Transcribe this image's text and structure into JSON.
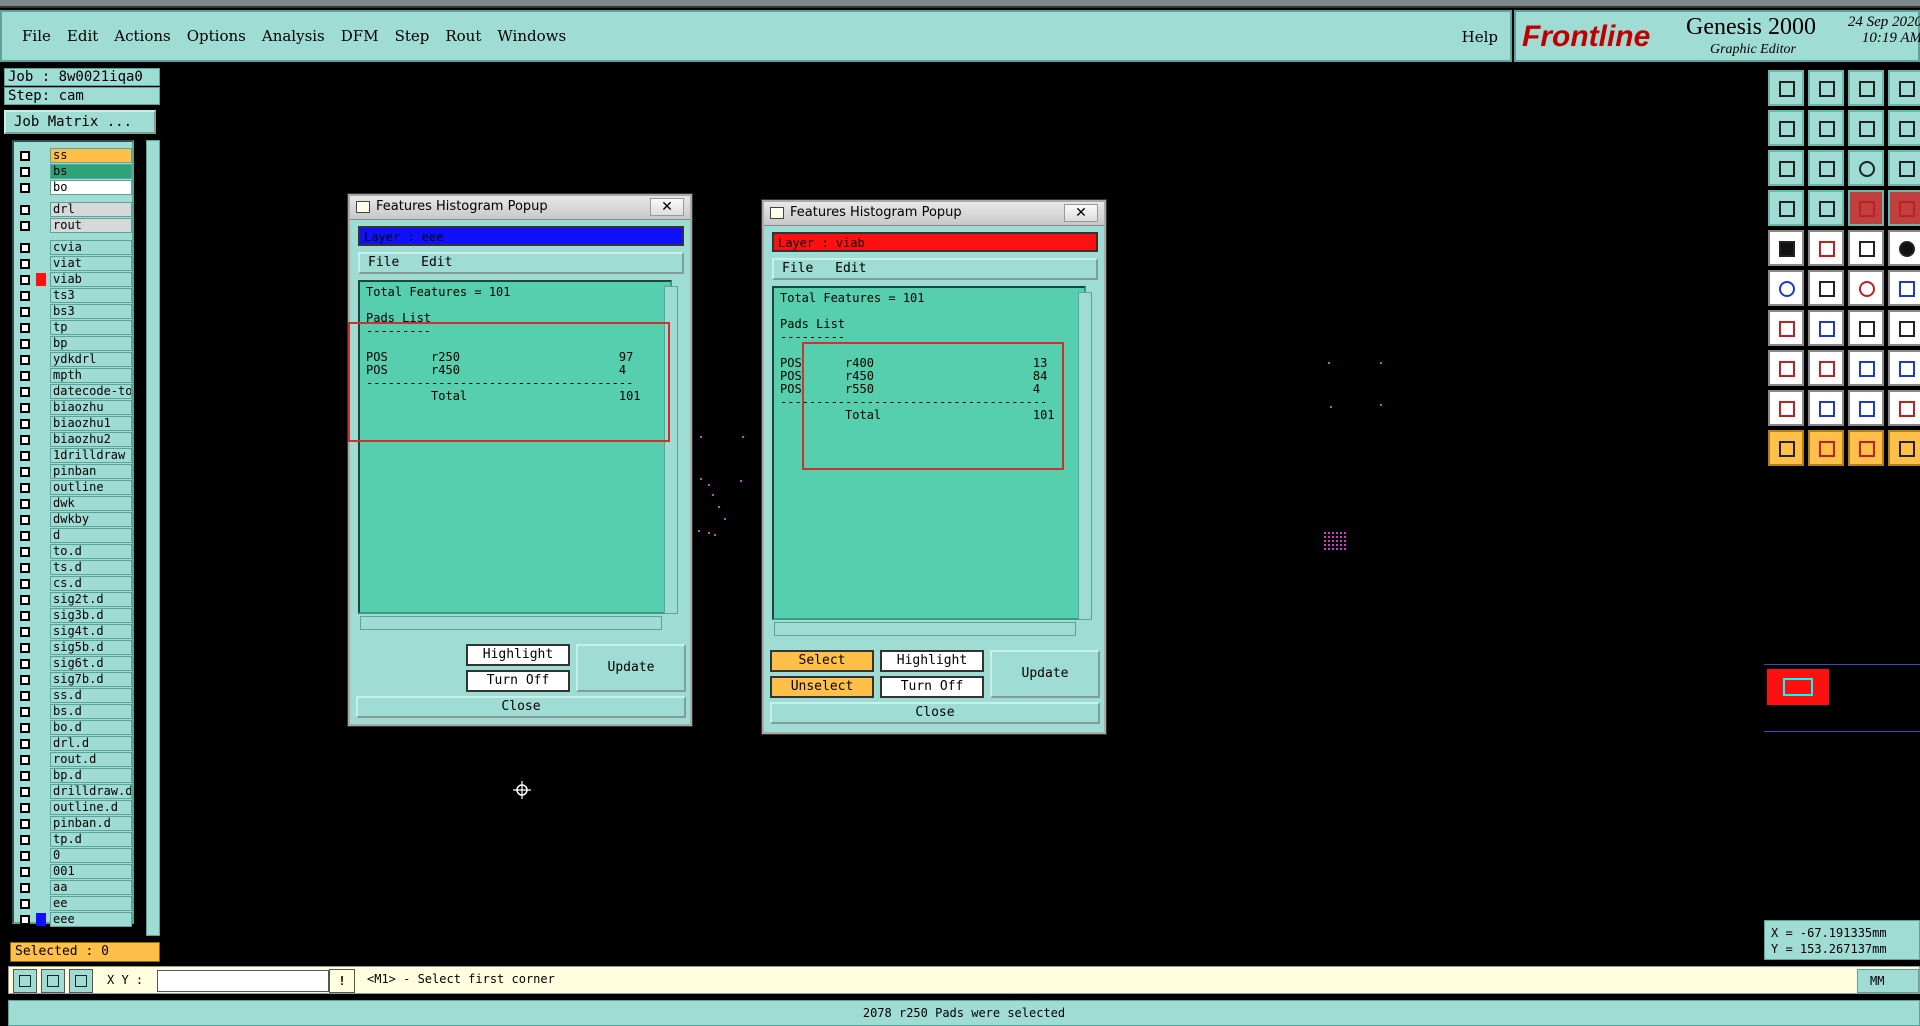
{
  "menubar": {
    "items": [
      "File",
      "Edit",
      "Actions",
      "Options",
      "Analysis",
      "DFM",
      "Step",
      "Rout",
      "Windows"
    ],
    "help": "Help"
  },
  "brand": {
    "logo_text": "Frontline",
    "product": "Genesis 2000",
    "subtitle": "Graphic Editor",
    "date": "24 Sep 2020",
    "time": "10:19 AM"
  },
  "job": {
    "job_label": "Job : 8w0021iqa0",
    "step_label": "Step: cam",
    "matrix_button": "Job Matrix ..."
  },
  "layers": [
    {
      "name": "ss",
      "color": "#ffc04a"
    },
    {
      "name": "bs",
      "color": "#2ea37a"
    },
    {
      "name": "bo",
      "color": "#ffffff"
    },
    {
      "name": "drl",
      "color": "#d8d8d8"
    },
    {
      "name": "rout",
      "color": "#d8d8d8"
    },
    {
      "name": "cvia",
      "color": ""
    },
    {
      "name": "viat",
      "color": ""
    },
    {
      "name": "viab",
      "color": "",
      "swatch": "#ff1010"
    },
    {
      "name": "ts3",
      "color": ""
    },
    {
      "name": "bs3",
      "color": ""
    },
    {
      "name": "tp",
      "color": ""
    },
    {
      "name": "bp",
      "color": ""
    },
    {
      "name": "ydkdrl",
      "color": ""
    },
    {
      "name": "mpth",
      "color": ""
    },
    {
      "name": "datecode-to",
      "color": ""
    },
    {
      "name": "biaozhu",
      "color": ""
    },
    {
      "name": "biaozhu1",
      "color": ""
    },
    {
      "name": "biaozhu2",
      "color": ""
    },
    {
      "name": "1drilldraw",
      "color": ""
    },
    {
      "name": "pinban",
      "color": ""
    },
    {
      "name": "outline",
      "color": ""
    },
    {
      "name": "dwk",
      "color": ""
    },
    {
      "name": "dwkby",
      "color": ""
    },
    {
      "name": "d",
      "color": ""
    },
    {
      "name": "to.d",
      "color": ""
    },
    {
      "name": "ts.d",
      "color": ""
    },
    {
      "name": "cs.d",
      "color": ""
    },
    {
      "name": "sig2t.d",
      "color": ""
    },
    {
      "name": "sig3b.d",
      "color": ""
    },
    {
      "name": "sig4t.d",
      "color": ""
    },
    {
      "name": "sig5b.d",
      "color": ""
    },
    {
      "name": "sig6t.d",
      "color": ""
    },
    {
      "name": "sig7b.d",
      "color": ""
    },
    {
      "name": "ss.d",
      "color": ""
    },
    {
      "name": "bs.d",
      "color": ""
    },
    {
      "name": "bo.d",
      "color": ""
    },
    {
      "name": "drl.d",
      "color": ""
    },
    {
      "name": "rout.d",
      "color": ""
    },
    {
      "name": "bp.d",
      "color": ""
    },
    {
      "name": "drilldraw.d",
      "color": ""
    },
    {
      "name": "outline.d",
      "color": ""
    },
    {
      "name": "pinban.d",
      "color": ""
    },
    {
      "name": "tp.d",
      "color": ""
    },
    {
      "name": "0",
      "color": ""
    },
    {
      "name": "001",
      "color": ""
    },
    {
      "name": "aa",
      "color": ""
    },
    {
      "name": "ee",
      "color": ""
    },
    {
      "name": "eee",
      "color": "",
      "swatch": "#1010ff"
    }
  ],
  "selected_label": "Selected : 0",
  "popup1": {
    "title": "Features Histogram Popup",
    "close_glyph": "✕",
    "layer_label": "Layer :  eee",
    "layer_color": "#1010ff",
    "menu": [
      "File",
      "Edit"
    ],
    "text": "Total Features = 101\n\nPads List\n---------\n\nPOS      r250                      97\nPOS      r450                      4\n-------------------------------------\n         Total                     101",
    "buttons": {
      "highlight": "Highlight",
      "turn_off": "Turn Off",
      "update": "Update",
      "close": "Close"
    }
  },
  "popup2": {
    "title": "Features Histogram Popup",
    "close_glyph": "✕",
    "layer_label": "Layer :  viab",
    "layer_color": "#ff1010",
    "menu": [
      "File",
      "Edit"
    ],
    "text": "Total Features = 101\n\nPads List\n---------\n\nPOS      r400                      13\nPOS      r450                      84\nPOS      r550                      4\n-------------------------------------\n         Total                     101",
    "buttons": {
      "select": "Select",
      "highlight": "Highlight",
      "unselect": "Unselect",
      "turn_off": "Turn Off",
      "update": "Update",
      "close": "Close"
    }
  },
  "coords": {
    "x": "X = -67.191335mm",
    "y": "Y = 153.267137mm"
  },
  "command": {
    "xy_label": "X Y :",
    "xy_value": "",
    "warn_glyph": "!",
    "message": "<M1> - Select first corner",
    "units": "MM"
  },
  "status": "2078 r250 Pads were selected"
}
